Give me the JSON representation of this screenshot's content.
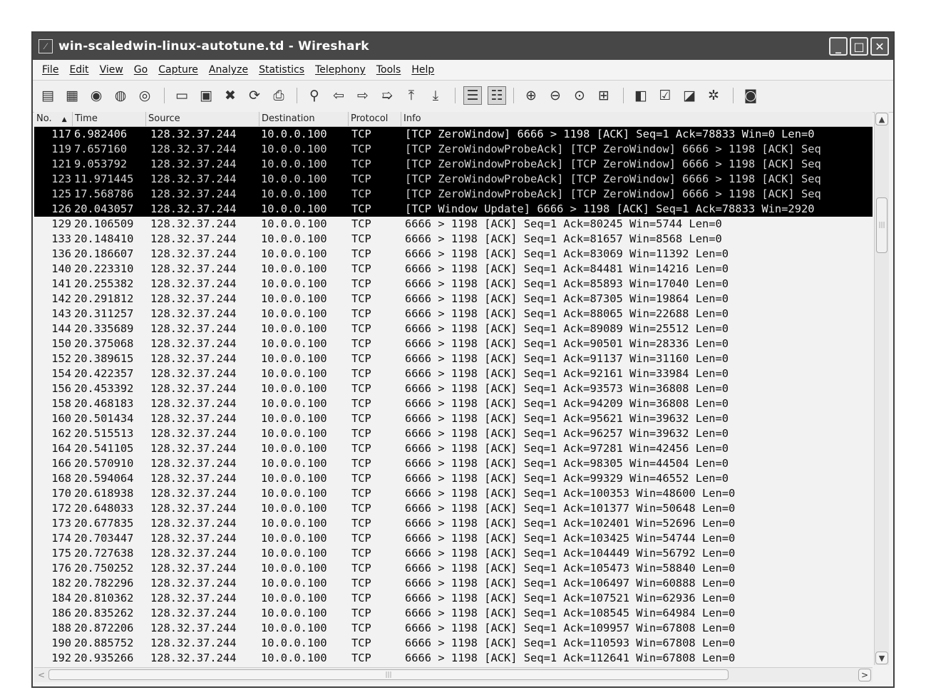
{
  "window": {
    "title": "win-scaledwin-linux-autotune.td - Wireshark",
    "app_icon": "wireshark-fin-icon",
    "buttons": {
      "minimize": "_",
      "maximize": "□",
      "close": "✕"
    }
  },
  "menu": [
    "File",
    "Edit",
    "View",
    "Go",
    "Capture",
    "Analyze",
    "Statistics",
    "Telephony",
    "Tools",
    "Help"
  ],
  "toolbar": {
    "icons": [
      {
        "name": "list-interfaces-icon",
        "glyph": "▤"
      },
      {
        "name": "capture-options-icon",
        "glyph": "▦"
      },
      {
        "name": "start-capture-icon",
        "glyph": "◉"
      },
      {
        "name": "stop-capture-icon",
        "glyph": "◍"
      },
      {
        "name": "restart-capture-icon",
        "glyph": "◎"
      },
      {
        "name": "open-file-icon",
        "glyph": "▭"
      },
      {
        "name": "save-file-icon",
        "glyph": "▣"
      },
      {
        "name": "close-file-icon",
        "glyph": "✖"
      },
      {
        "name": "reload-icon",
        "glyph": "⟳"
      },
      {
        "name": "print-icon",
        "glyph": "⎙"
      },
      {
        "name": "find-packet-icon",
        "glyph": "⚲"
      },
      {
        "name": "go-back-icon",
        "glyph": "⇦"
      },
      {
        "name": "go-forward-icon",
        "glyph": "⇨"
      },
      {
        "name": "go-to-packet-icon",
        "glyph": "➯"
      },
      {
        "name": "go-first-icon",
        "glyph": "⤒"
      },
      {
        "name": "go-last-icon",
        "glyph": "⤓"
      },
      {
        "name": "colorize-icon",
        "glyph": "☰"
      },
      {
        "name": "auto-scroll-icon",
        "glyph": "☷"
      },
      {
        "name": "zoom-in-icon",
        "glyph": "⊕"
      },
      {
        "name": "zoom-out-icon",
        "glyph": "⊖"
      },
      {
        "name": "zoom-normal-icon",
        "glyph": "⊙"
      },
      {
        "name": "resize-columns-icon",
        "glyph": "⊞"
      },
      {
        "name": "capture-filters-icon",
        "glyph": "◧"
      },
      {
        "name": "display-filters-icon",
        "glyph": "☑"
      },
      {
        "name": "coloring-rules-icon",
        "glyph": "◪"
      },
      {
        "name": "preferences-icon",
        "glyph": "✲"
      },
      {
        "name": "help-icon",
        "glyph": "◙"
      }
    ]
  },
  "columns": [
    "No.",
    "Time",
    "Source",
    "Destination",
    "Protocol",
    "Info"
  ],
  "sort_indicator": "▲",
  "packets": [
    {
      "no": "117",
      "time": "6.982406",
      "src": "128.32.37.244",
      "dst": "10.0.0.100",
      "proto": "TCP",
      "info": "[TCP ZeroWindow] 6666 > 1198 [ACK] Seq=1 Ack=78833 Win=0 Len=0"
    },
    {
      "no": "119",
      "time": "7.657160",
      "src": "128.32.37.244",
      "dst": "10.0.0.100",
      "proto": "TCP",
      "info": "[TCP ZeroWindowProbeAck] [TCP ZeroWindow] 6666 > 1198 [ACK] Seq"
    },
    {
      "no": "121",
      "time": "9.053792",
      "src": "128.32.37.244",
      "dst": "10.0.0.100",
      "proto": "TCP",
      "info": "[TCP ZeroWindowProbeAck] [TCP ZeroWindow] 6666 > 1198 [ACK] Seq"
    },
    {
      "no": "123",
      "time": "11.971445",
      "src": "128.32.37.244",
      "dst": "10.0.0.100",
      "proto": "TCP",
      "info": "[TCP ZeroWindowProbeAck] [TCP ZeroWindow] 6666 > 1198 [ACK] Seq"
    },
    {
      "no": "125",
      "time": "17.568786",
      "src": "128.32.37.244",
      "dst": "10.0.0.100",
      "proto": "TCP",
      "info": "[TCP ZeroWindowProbeAck] [TCP ZeroWindow] 6666 > 1198 [ACK] Seq"
    },
    {
      "no": "126",
      "time": "20.043057",
      "src": "128.32.37.244",
      "dst": "10.0.0.100",
      "proto": "TCP",
      "info": "[TCP Window Update] 6666 > 1198 [ACK] Seq=1 Ack=78833 Win=2920"
    },
    {
      "no": "129",
      "time": "20.106509",
      "src": "128.32.37.244",
      "dst": "10.0.0.100",
      "proto": "TCP",
      "info": "6666 > 1198 [ACK] Seq=1 Ack=80245 Win=5744 Len=0"
    },
    {
      "no": "133",
      "time": "20.148410",
      "src": "128.32.37.244",
      "dst": "10.0.0.100",
      "proto": "TCP",
      "info": "6666 > 1198 [ACK] Seq=1 Ack=81657 Win=8568 Len=0"
    },
    {
      "no": "136",
      "time": "20.186607",
      "src": "128.32.37.244",
      "dst": "10.0.0.100",
      "proto": "TCP",
      "info": "6666 > 1198 [ACK] Seq=1 Ack=83069 Win=11392 Len=0"
    },
    {
      "no": "140",
      "time": "20.223310",
      "src": "128.32.37.244",
      "dst": "10.0.0.100",
      "proto": "TCP",
      "info": "6666 > 1198 [ACK] Seq=1 Ack=84481 Win=14216 Len=0"
    },
    {
      "no": "141",
      "time": "20.255382",
      "src": "128.32.37.244",
      "dst": "10.0.0.100",
      "proto": "TCP",
      "info": "6666 > 1198 [ACK] Seq=1 Ack=85893 Win=17040 Len=0"
    },
    {
      "no": "142",
      "time": "20.291812",
      "src": "128.32.37.244",
      "dst": "10.0.0.100",
      "proto": "TCP",
      "info": "6666 > 1198 [ACK] Seq=1 Ack=87305 Win=19864 Len=0"
    },
    {
      "no": "143",
      "time": "20.311257",
      "src": "128.32.37.244",
      "dst": "10.0.0.100",
      "proto": "TCP",
      "info": "6666 > 1198 [ACK] Seq=1 Ack=88065 Win=22688 Len=0"
    },
    {
      "no": "144",
      "time": "20.335689",
      "src": "128.32.37.244",
      "dst": "10.0.0.100",
      "proto": "TCP",
      "info": "6666 > 1198 [ACK] Seq=1 Ack=89089 Win=25512 Len=0"
    },
    {
      "no": "150",
      "time": "20.375068",
      "src": "128.32.37.244",
      "dst": "10.0.0.100",
      "proto": "TCP",
      "info": "6666 > 1198 [ACK] Seq=1 Ack=90501 Win=28336 Len=0"
    },
    {
      "no": "152",
      "time": "20.389615",
      "src": "128.32.37.244",
      "dst": "10.0.0.100",
      "proto": "TCP",
      "info": "6666 > 1198 [ACK] Seq=1 Ack=91137 Win=31160 Len=0"
    },
    {
      "no": "154",
      "time": "20.422357",
      "src": "128.32.37.244",
      "dst": "10.0.0.100",
      "proto": "TCP",
      "info": "6666 > 1198 [ACK] Seq=1 Ack=92161 Win=33984 Len=0"
    },
    {
      "no": "156",
      "time": "20.453392",
      "src": "128.32.37.244",
      "dst": "10.0.0.100",
      "proto": "TCP",
      "info": "6666 > 1198 [ACK] Seq=1 Ack=93573 Win=36808 Len=0"
    },
    {
      "no": "158",
      "time": "20.468183",
      "src": "128.32.37.244",
      "dst": "10.0.0.100",
      "proto": "TCP",
      "info": "6666 > 1198 [ACK] Seq=1 Ack=94209 Win=36808 Len=0"
    },
    {
      "no": "160",
      "time": "20.501434",
      "src": "128.32.37.244",
      "dst": "10.0.0.100",
      "proto": "TCP",
      "info": "6666 > 1198 [ACK] Seq=1 Ack=95621 Win=39632 Len=0"
    },
    {
      "no": "162",
      "time": "20.515513",
      "src": "128.32.37.244",
      "dst": "10.0.0.100",
      "proto": "TCP",
      "info": "6666 > 1198 [ACK] Seq=1 Ack=96257 Win=39632 Len=0"
    },
    {
      "no": "164",
      "time": "20.541105",
      "src": "128.32.37.244",
      "dst": "10.0.0.100",
      "proto": "TCP",
      "info": "6666 > 1198 [ACK] Seq=1 Ack=97281 Win=42456 Len=0"
    },
    {
      "no": "166",
      "time": "20.570910",
      "src": "128.32.37.244",
      "dst": "10.0.0.100",
      "proto": "TCP",
      "info": "6666 > 1198 [ACK] Seq=1 Ack=98305 Win=44504 Len=0"
    },
    {
      "no": "168",
      "time": "20.594064",
      "src": "128.32.37.244",
      "dst": "10.0.0.100",
      "proto": "TCP",
      "info": "6666 > 1198 [ACK] Seq=1 Ack=99329 Win=46552 Len=0"
    },
    {
      "no": "170",
      "time": "20.618938",
      "src": "128.32.37.244",
      "dst": "10.0.0.100",
      "proto": "TCP",
      "info": "6666 > 1198 [ACK] Seq=1 Ack=100353 Win=48600 Len=0"
    },
    {
      "no": "172",
      "time": "20.648033",
      "src": "128.32.37.244",
      "dst": "10.0.0.100",
      "proto": "TCP",
      "info": "6666 > 1198 [ACK] Seq=1 Ack=101377 Win=50648 Len=0"
    },
    {
      "no": "173",
      "time": "20.677835",
      "src": "128.32.37.244",
      "dst": "10.0.0.100",
      "proto": "TCP",
      "info": "6666 > 1198 [ACK] Seq=1 Ack=102401 Win=52696 Len=0"
    },
    {
      "no": "174",
      "time": "20.703447",
      "src": "128.32.37.244",
      "dst": "10.0.0.100",
      "proto": "TCP",
      "info": "6666 > 1198 [ACK] Seq=1 Ack=103425 Win=54744 Len=0"
    },
    {
      "no": "175",
      "time": "20.727638",
      "src": "128.32.37.244",
      "dst": "10.0.0.100",
      "proto": "TCP",
      "info": "6666 > 1198 [ACK] Seq=1 Ack=104449 Win=56792 Len=0"
    },
    {
      "no": "176",
      "time": "20.750252",
      "src": "128.32.37.244",
      "dst": "10.0.0.100",
      "proto": "TCP",
      "info": "6666 > 1198 [ACK] Seq=1 Ack=105473 Win=58840 Len=0"
    },
    {
      "no": "182",
      "time": "20.782296",
      "src": "128.32.37.244",
      "dst": "10.0.0.100",
      "proto": "TCP",
      "info": "6666 > 1198 [ACK] Seq=1 Ack=106497 Win=60888 Len=0"
    },
    {
      "no": "184",
      "time": "20.810362",
      "src": "128.32.37.244",
      "dst": "10.0.0.100",
      "proto": "TCP",
      "info": "6666 > 1198 [ACK] Seq=1 Ack=107521 Win=62936 Len=0"
    },
    {
      "no": "186",
      "time": "20.835262",
      "src": "128.32.37.244",
      "dst": "10.0.0.100",
      "proto": "TCP",
      "info": "6666 > 1198 [ACK] Seq=1 Ack=108545 Win=64984 Len=0"
    },
    {
      "no": "188",
      "time": "20.872206",
      "src": "128.32.37.244",
      "dst": "10.0.0.100",
      "proto": "TCP",
      "info": "6666 > 1198 [ACK] Seq=1 Ack=109957 Win=67808 Len=0"
    },
    {
      "no": "190",
      "time": "20.885752",
      "src": "128.32.37.244",
      "dst": "10.0.0.100",
      "proto": "TCP",
      "info": "6666 > 1198 [ACK] Seq=1 Ack=110593 Win=67808 Len=0"
    },
    {
      "no": "192",
      "time": "20.935266",
      "src": "128.32.37.244",
      "dst": "10.0.0.100",
      "proto": "TCP",
      "info": "6666 > 1198 [ACK] Seq=1 Ack=112641 Win=67808 Len=0"
    }
  ],
  "highlighted_rows": [
    0,
    1,
    2,
    3,
    4,
    5
  ],
  "scrollbars": {
    "up_arrow": "▲",
    "down_arrow": "▼",
    "left_arrow": "<",
    "right_arrow": ">",
    "grip": "|||"
  }
}
